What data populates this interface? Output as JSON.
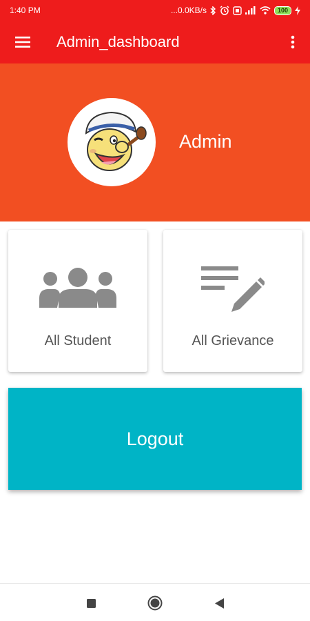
{
  "status_bar": {
    "time": "1:40 PM",
    "network_speed": "...0.0KB/s",
    "battery": "100"
  },
  "app_bar": {
    "title": "Admin_dashboard",
    "menu_icon": "hamburger-menu-icon",
    "overflow_icon": "more-vert-icon"
  },
  "profile": {
    "name": "Admin",
    "avatar_icon": "popeye-avatar"
  },
  "cards": [
    {
      "label": "All Student",
      "icon": "people-group-icon"
    },
    {
      "label": "All Grievance",
      "icon": "edit-list-icon"
    }
  ],
  "logout": {
    "label": "Logout"
  },
  "colors": {
    "app_bar": "#ee1c1c",
    "header": "#f24f22",
    "logout": "#00b4c6",
    "card_text": "#555555",
    "icon": "#8a8a8a"
  },
  "nav_bar": {
    "recents_icon": "square-icon",
    "home_icon": "circle-home-icon",
    "back_icon": "triangle-back-icon"
  }
}
